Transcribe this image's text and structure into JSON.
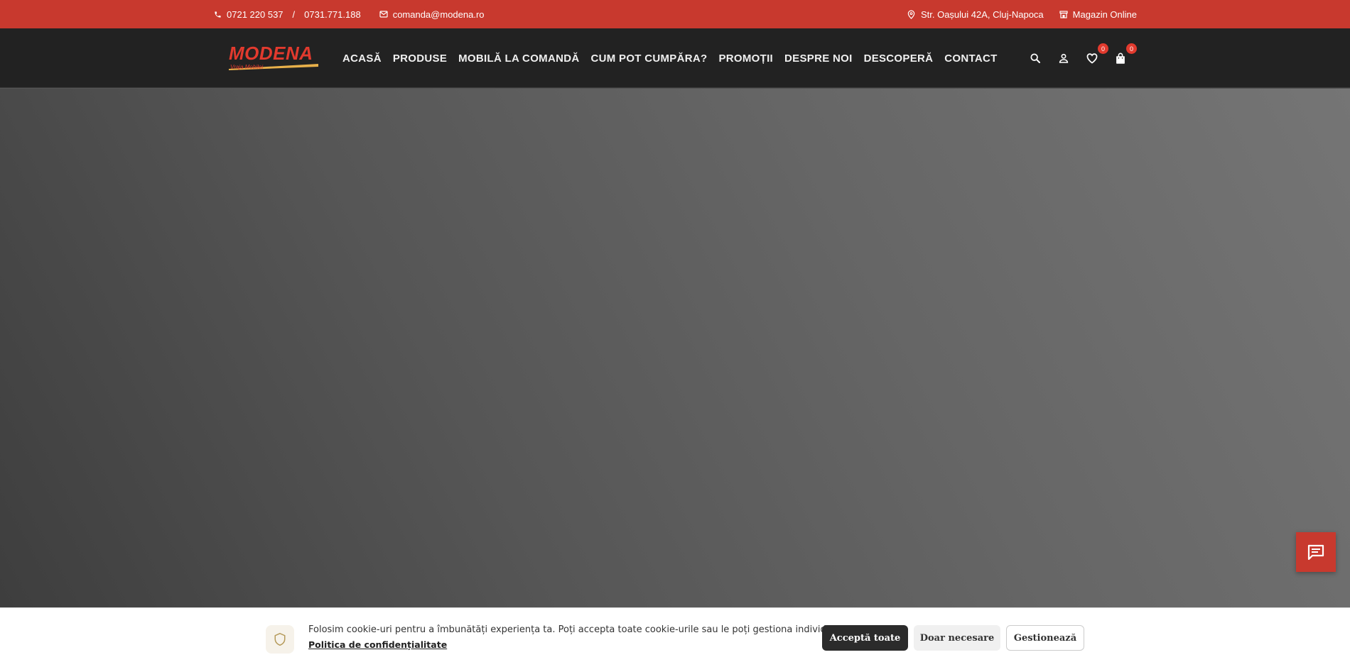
{
  "topbar": {
    "phone1": "0721 220 537",
    "phone_sep": "/",
    "phone2": "0731.771.188",
    "email": "comanda@modena.ro",
    "address": "Str. Oașului 42A, Cluj-Napoca",
    "shop": "Magazin Online"
  },
  "logo": {
    "brand": "MODENA",
    "tagline": "Vraja Mobilei"
  },
  "nav": {
    "items": [
      "ACASĂ",
      "PRODUSE",
      "MOBILĂ LA COMANDĂ",
      "CUM POT CUMPĂRA?",
      "PROMOȚII",
      "DESPRE NOI",
      "DESCOPERĂ",
      "CONTACT"
    ]
  },
  "header_icons": {
    "wishlist_count": "0",
    "cart_count": "0"
  },
  "cookie": {
    "message": "Folosim cookie-uri pentru a îmbunătăți experiența ta. Poți accepta toate cookie-urile sau le poți gestiona individual.",
    "policy_link": "Politica de confidențialitate",
    "accept_all": "Acceptă toate",
    "only_necessary": "Doar necesare",
    "manage": "Gestionează"
  },
  "colors": {
    "brand_red": "#c8392e",
    "header_bg": "#222222"
  },
  "icons": [
    "phone-icon",
    "mail-icon",
    "location-pin-icon",
    "store-icon",
    "search-icon",
    "user-icon",
    "heart-icon",
    "bag-icon",
    "chat-icon",
    "shield-icon"
  ]
}
